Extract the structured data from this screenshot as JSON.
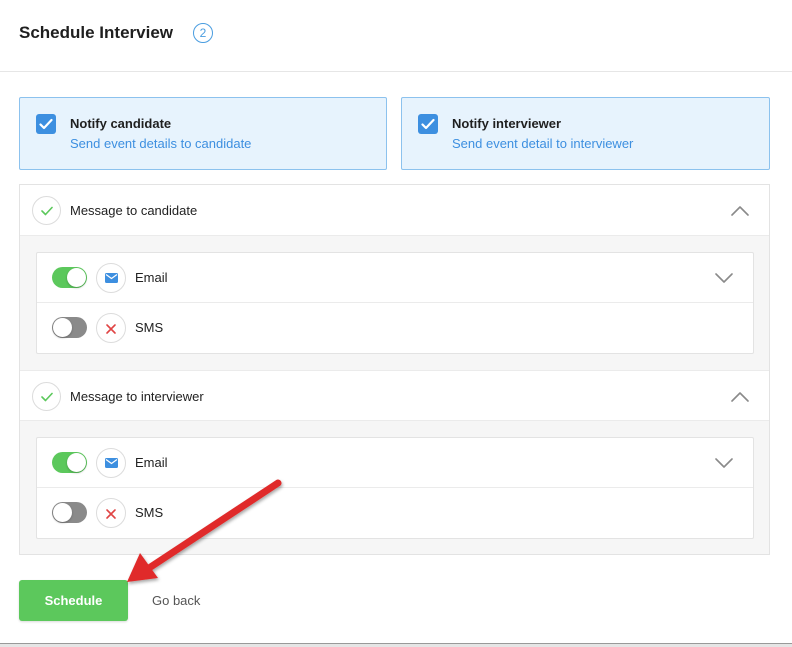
{
  "header": {
    "title": "Schedule Interview",
    "step": "2"
  },
  "notify": {
    "candidate": {
      "title": "Notify candidate",
      "description": "Send event details to candidate",
      "checked": true
    },
    "interviewer": {
      "title": "Notify interviewer",
      "description": "Send event detail to interviewer",
      "checked": true
    }
  },
  "messages": [
    {
      "title": "Message to candidate",
      "channels": [
        {
          "label": "Email",
          "enabled": true,
          "icon": "envelope-icon"
        },
        {
          "label": "SMS",
          "enabled": false,
          "icon": "close-icon"
        }
      ]
    },
    {
      "title": "Message to interviewer",
      "channels": [
        {
          "label": "Email",
          "enabled": true,
          "icon": "envelope-icon"
        },
        {
          "label": "SMS",
          "enabled": false,
          "icon": "close-icon"
        }
      ]
    }
  ],
  "actions": {
    "schedule_label": "Schedule",
    "go_back_label": "Go back"
  },
  "colors": {
    "accent_blue": "#3d8fe0",
    "toggle_on": "#5cc85c",
    "error_x": "#e04444",
    "annotation_arrow": "#e02a2a"
  }
}
